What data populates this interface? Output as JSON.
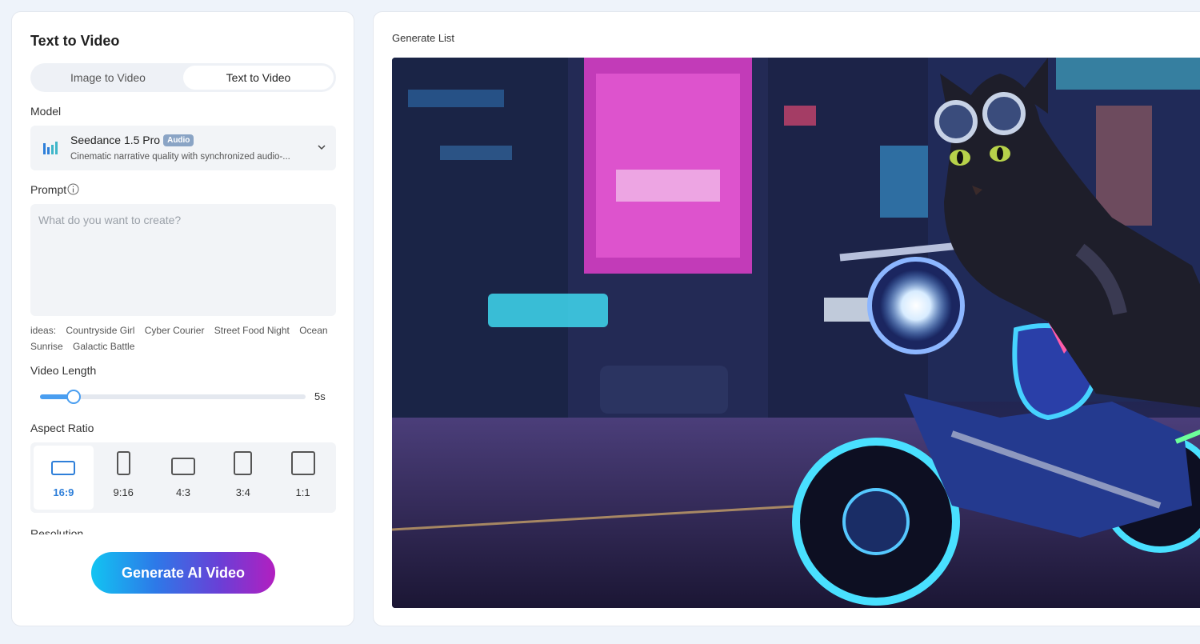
{
  "panel_title": "Text to Video",
  "mode_tabs": [
    {
      "label": "Image to Video",
      "active": false
    },
    {
      "label": "Text to Video",
      "active": true
    }
  ],
  "model": {
    "label": "Model",
    "name": "Seedance 1.5 Pro",
    "badge": "Audio",
    "description": "Cinematic narrative quality with synchronized audio-...",
    "icon": "bar-chart-icon"
  },
  "prompt": {
    "label": "Prompt",
    "placeholder": "What do you want to create?",
    "value": ""
  },
  "ideas": {
    "label": "ideas:",
    "items": [
      "Countryside Girl",
      "Cyber Courier",
      "Street Food Night",
      "Ocean Sunrise",
      "Galactic Battle"
    ]
  },
  "video_length": {
    "label": "Video Length",
    "value_text": "5s",
    "fraction": 0.125
  },
  "aspect_ratio": {
    "label": "Aspect Ratio",
    "options": [
      {
        "label": "16:9",
        "active": true
      },
      {
        "label": "9:16",
        "active": false
      },
      {
        "label": "4:3",
        "active": false
      },
      {
        "label": "3:4",
        "active": false
      },
      {
        "label": "1:1",
        "active": false
      }
    ]
  },
  "resolution": {
    "label": "Resolution"
  },
  "generate_button": "Generate AI Video",
  "generate_list": {
    "title": "Generate List"
  },
  "colors": {
    "accent": "#2e7fd9",
    "slider": "#4a9ef0",
    "button_gradient": [
      "#12c4f2",
      "#2d79e8",
      "#6a3fd6",
      "#b21fc0"
    ]
  }
}
